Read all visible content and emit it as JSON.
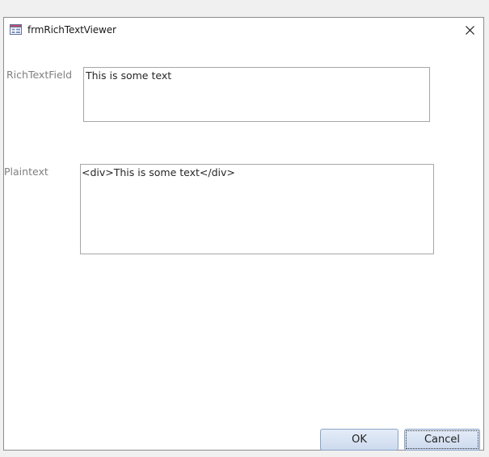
{
  "window": {
    "title": "frmRichTextViewer",
    "title_icon": "form-icon",
    "close_icon": "close-icon"
  },
  "form": {
    "richtext_label": "RichTextField",
    "richtext_value": "This is some text",
    "plaintext_label": "Plaintext",
    "plaintext_value": "<div>This is some text</div>"
  },
  "buttons": {
    "ok_label": "OK",
    "cancel_label": "Cancel"
  }
}
